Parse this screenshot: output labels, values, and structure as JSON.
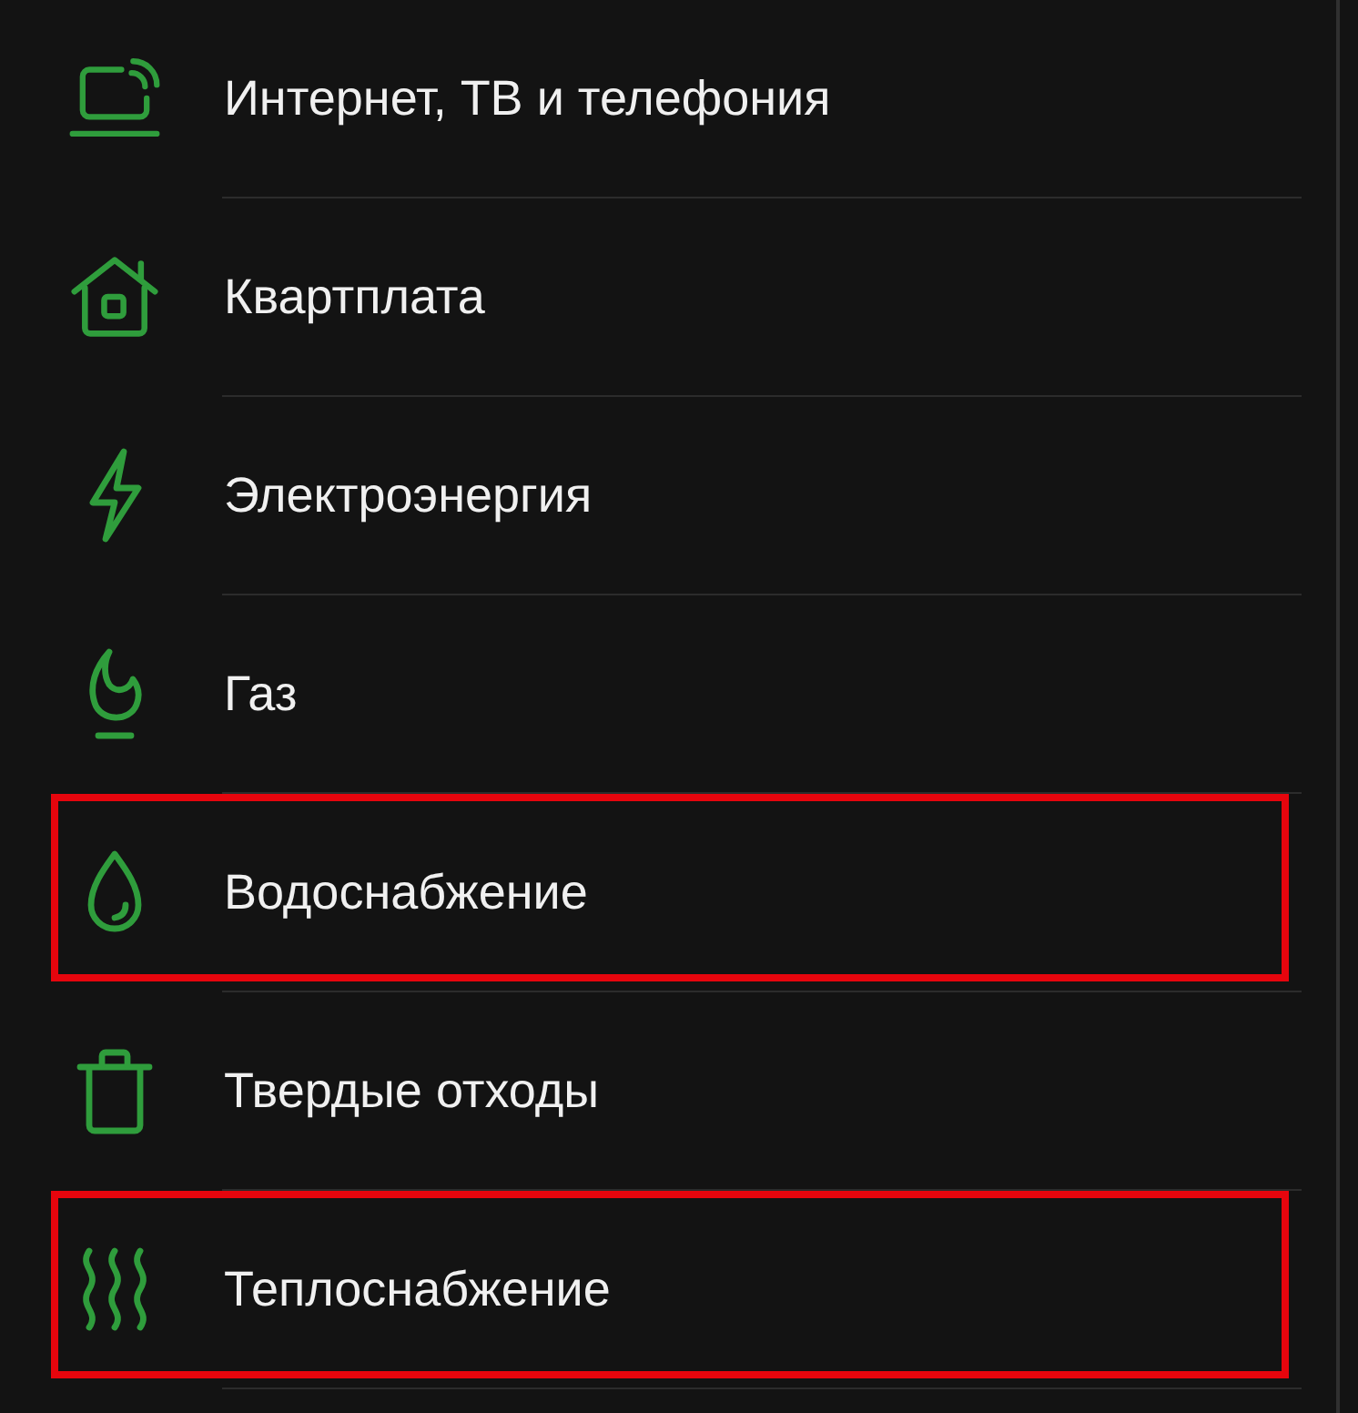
{
  "items": [
    {
      "kind": "internet",
      "label": "Интернет, ТВ и телефония",
      "highlighted": false
    },
    {
      "kind": "housing",
      "label": "Квартплата",
      "highlighted": false
    },
    {
      "kind": "electricity",
      "label": "Электроэнергия",
      "highlighted": false
    },
    {
      "kind": "gas",
      "label": "Газ",
      "highlighted": false
    },
    {
      "kind": "water",
      "label": "Водоснабжение",
      "highlighted": true
    },
    {
      "kind": "waste",
      "label": "Твердые отходы",
      "highlighted": false
    },
    {
      "kind": "heating",
      "label": "Теплоснабжение",
      "highlighted": true
    }
  ]
}
